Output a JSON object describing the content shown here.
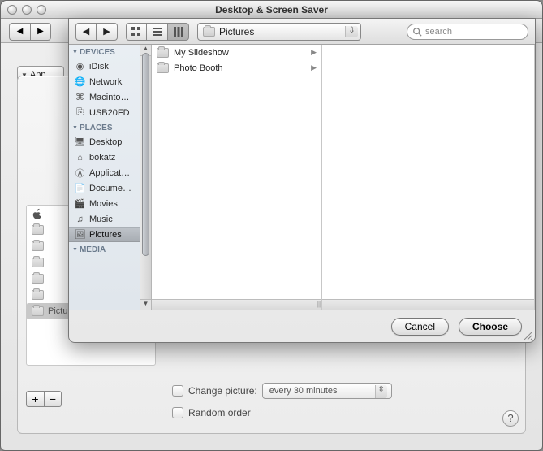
{
  "window": {
    "title": "Desktop & Screen Saver"
  },
  "pref": {
    "visible_tab": "App",
    "sidebar_sel_label": "Pictures Folder",
    "change_picture_label": "Change picture:",
    "change_picture_value": "every 30 minutes",
    "random_order_label": "Random order"
  },
  "sheet": {
    "path_label": "Pictures",
    "search_placeholder": "search",
    "cancel_label": "Cancel",
    "choose_label": "Choose",
    "sidebar": {
      "sections": [
        {
          "title": "DEVICES",
          "items": [
            {
              "icon": "idisk-icon",
              "label": "iDisk"
            },
            {
              "icon": "globe-icon",
              "label": "Network"
            },
            {
              "icon": "hdd-icon",
              "label": "Macinto…"
            },
            {
              "icon": "usb-icon",
              "label": "USB20FD"
            }
          ]
        },
        {
          "title": "PLACES",
          "items": [
            {
              "icon": "desktop-icon",
              "label": "Desktop"
            },
            {
              "icon": "home-icon",
              "label": "bokatz"
            },
            {
              "icon": "app-icon",
              "label": "Applicat…"
            },
            {
              "icon": "doc-icon",
              "label": "Docume…"
            },
            {
              "icon": "movie-icon",
              "label": "Movies"
            },
            {
              "icon": "music-icon",
              "label": "Music"
            },
            {
              "icon": "pictures-icon",
              "label": "Pictures",
              "selected": true
            }
          ]
        },
        {
          "title": "MEDIA",
          "items": []
        }
      ]
    },
    "column_items": [
      {
        "icon": "folder-icon",
        "label": "My Slideshow"
      },
      {
        "icon": "folder-icon",
        "label": "Photo Booth"
      }
    ]
  }
}
